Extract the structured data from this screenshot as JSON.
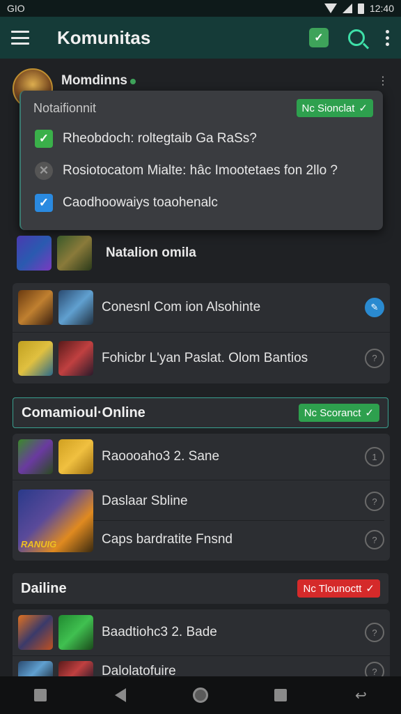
{
  "status_bar": {
    "carrier": "GIO",
    "time": "12:40"
  },
  "app_bar": {
    "title": "Komunitas",
    "notif_icon": "check-shield-icon",
    "search_icon": "search-icon"
  },
  "profile": {
    "name": "Momdinns"
  },
  "popup": {
    "title": "Notaifionnit",
    "badge": "Nc Sionclat",
    "items": [
      {
        "label": "Rheobdoch: roltegtaib Ga RaSs?",
        "state": "checked-green"
      },
      {
        "label": "Rosiotocatom Mialte: hâc Imootetaes fon 2llo ?",
        "state": "pending"
      },
      {
        "label": "Caodhoowaiys toaohenalc",
        "state": "checked-blue"
      }
    ]
  },
  "featured": {
    "label": "Natalion omila"
  },
  "group1": {
    "rows": [
      {
        "text": "Conesnl Com ion Alsohinte",
        "indicator": ""
      },
      {
        "text": "Fohicbr L'yan Paslat. Olom Bantios",
        "indicator": ""
      }
    ]
  },
  "section_online": {
    "title": "Comamioul·Online",
    "badge": "Nc Scoranct"
  },
  "group2": {
    "rows": [
      {
        "text": "Raoooaho3 2. Sane",
        "indicator": "1"
      },
      {
        "text": "Daslaar Sbline",
        "indicator": ""
      },
      {
        "text": "Caps bardratite Fnsnd",
        "indicator": ""
      }
    ],
    "big_icon_text": "RANUIG"
  },
  "section_dailine": {
    "title": "Dailine",
    "badge": "Nc Tlounoctt"
  },
  "group3": {
    "rows": [
      {
        "text": "Baadtiohc3 2. Bade",
        "indicator": ""
      },
      {
        "text": "Dalolatofuire",
        "indicator": ""
      }
    ]
  },
  "colors": {
    "accent": "#3ea35a",
    "appbar": "#153b38",
    "badge_red": "#d52a2a",
    "info_blue": "#2a8ad0"
  }
}
